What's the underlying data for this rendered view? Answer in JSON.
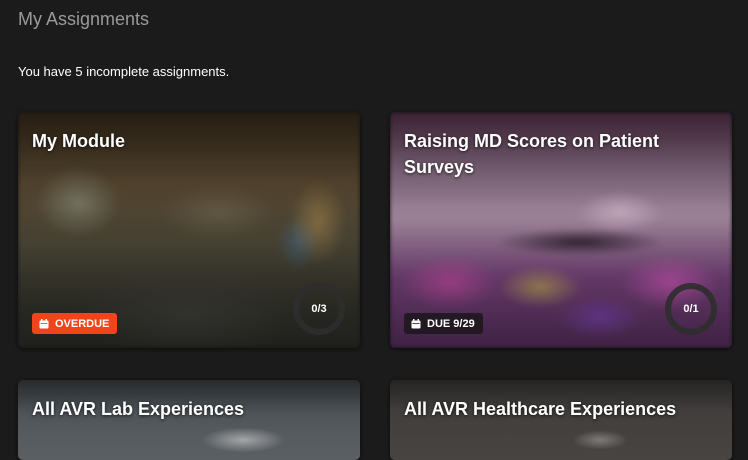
{
  "header": {
    "title": "My Assignments",
    "summary": "You have 5 incomplete assignments."
  },
  "assignments": [
    {
      "title": "My Module",
      "badge": {
        "label": "OVERDUE",
        "color": "#f0441c",
        "icon": "calendar-icon"
      },
      "progress": {
        "label": "0/3",
        "completed": 0,
        "total": 3
      }
    },
    {
      "title": "Raising MD Scores on Patient Surveys",
      "badge": {
        "label": "DUE 9/29",
        "color": "#1e1e1e",
        "icon": "calendar-icon"
      },
      "progress": {
        "label": "0/1",
        "completed": 0,
        "total": 1
      }
    },
    {
      "title": "All AVR Lab Experiences"
    },
    {
      "title": "All AVR Healthcare Experiences"
    }
  ],
  "colors": {
    "background": "#1b1b1b",
    "title_text": "#9a9a9a",
    "overdue": "#f0441c",
    "progress_ring": "#2e2e2e"
  }
}
